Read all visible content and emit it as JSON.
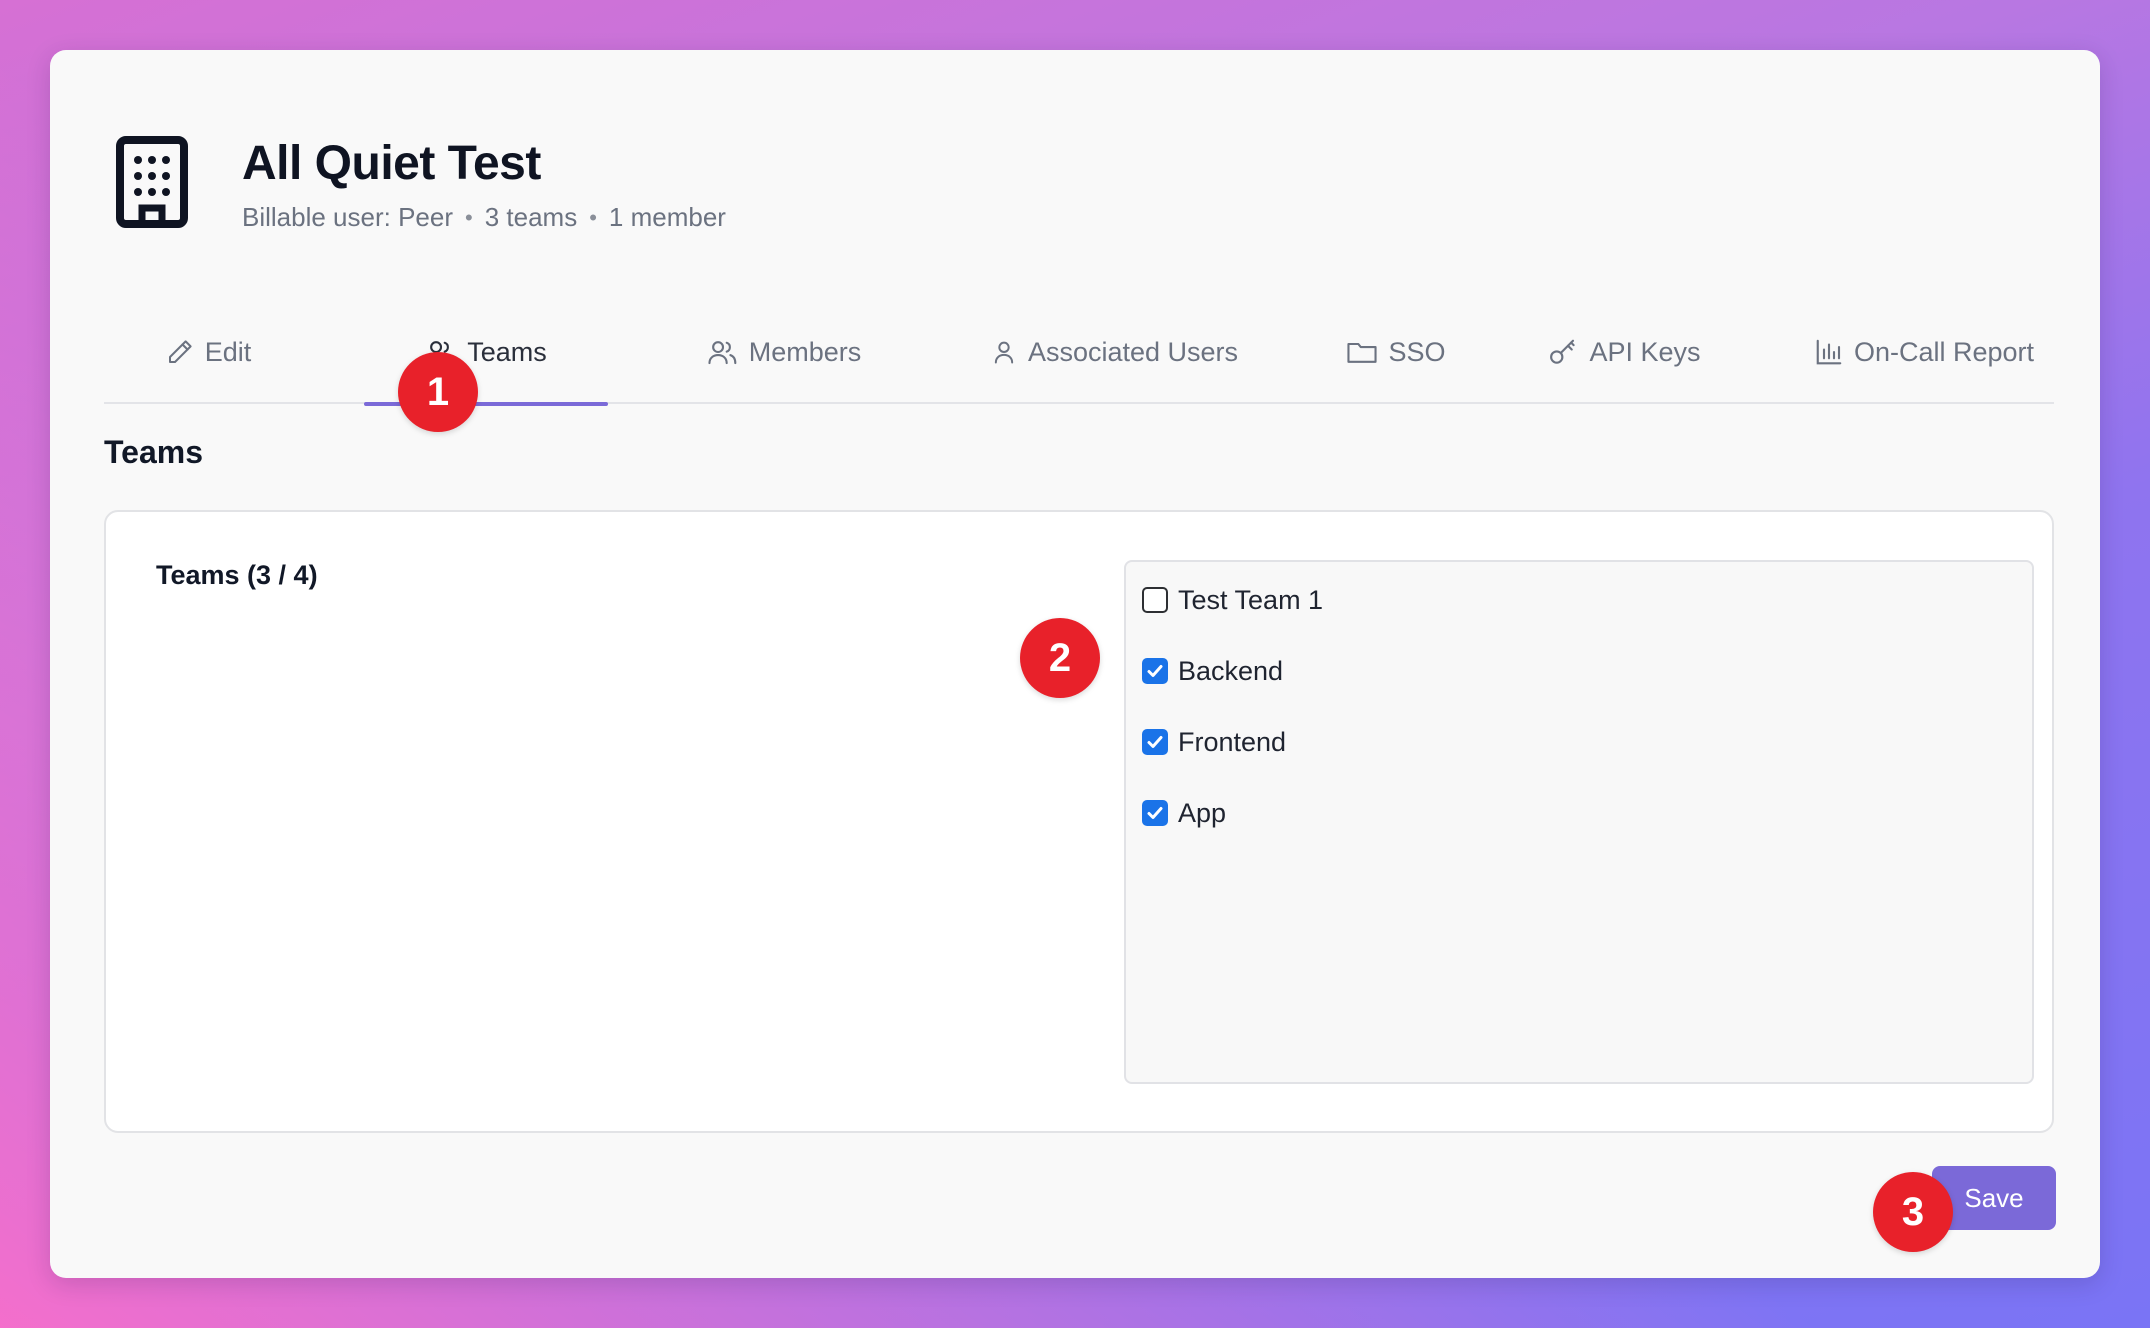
{
  "org": {
    "title": "All Quiet Test",
    "meta": [
      "Billable user: Peer",
      "3 teams",
      "1 member"
    ],
    "icon": "building-icon"
  },
  "tabs": [
    {
      "label": "Edit",
      "icon": "pencil-icon"
    },
    {
      "label": "Teams",
      "icon": "users-icon",
      "active": true
    },
    {
      "label": "Members",
      "icon": "users-icon"
    },
    {
      "label": "Associated Users",
      "icon": "user-icon"
    },
    {
      "label": "SSO",
      "icon": "folder-icon"
    },
    {
      "label": "API Keys",
      "icon": "key-icon"
    },
    {
      "label": "On-Call Report",
      "icon": "bar-chart-icon"
    }
  ],
  "section": {
    "title": "Teams"
  },
  "panel": {
    "label": "Teams (3 / 4)",
    "teams": [
      {
        "name": "Test Team 1",
        "checked": false
      },
      {
        "name": "Backend",
        "checked": true
      },
      {
        "name": "Frontend",
        "checked": true
      },
      {
        "name": "App",
        "checked": true
      }
    ]
  },
  "save_label": "Save",
  "annotations": [
    "1",
    "2",
    "3"
  ],
  "colors": {
    "accent": "#7b69d8",
    "checkbox": "#1a73e8",
    "badge": "#e8212a"
  }
}
